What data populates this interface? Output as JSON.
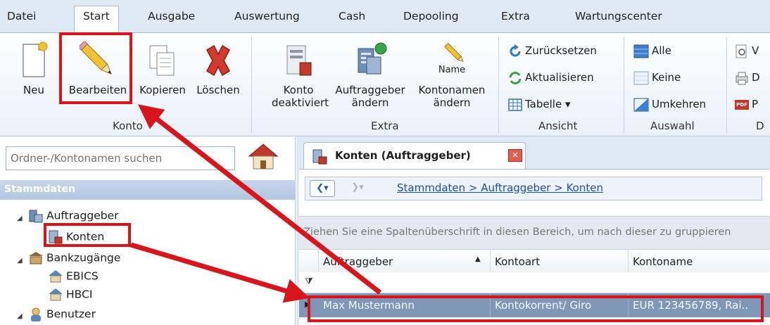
{
  "menu": {
    "tabs": [
      "Datei",
      "Start",
      "Ausgabe",
      "Auswertung",
      "Cash",
      "Depooling",
      "Extra",
      "Wartungscenter"
    ],
    "active": "Start"
  },
  "ribbon": {
    "konto": {
      "group_label": "Konto",
      "buttons": [
        "Neu",
        "Bearbeiten",
        "Kopieren",
        "Löschen"
      ]
    },
    "extra": {
      "group_label": "Extra",
      "konto_deaktiviert": [
        "Konto",
        "deaktiviert"
      ],
      "auftraggeber_aendern": [
        "Auftraggeber",
        "ändern"
      ],
      "kontonamen_aendern": [
        "Kontonamen",
        "ändern"
      ],
      "name_icon_text": "Name"
    },
    "ansicht": {
      "group_label": "Ansicht",
      "items": [
        "Zurücksetzen",
        "Aktualisieren",
        "Tabelle ▾"
      ]
    },
    "auswahl": {
      "group_label": "Auswahl",
      "items": [
        "Alle",
        "Keine",
        "Umkehren"
      ]
    },
    "cutoff": {
      "items": [
        "V",
        "D",
        "P"
      ],
      "group_label": "D",
      "pdf_icon_text": "PDF"
    }
  },
  "left": {
    "search_placeholder": "Ordner-/Kontonamen suchen",
    "header": "Stammdaten",
    "tree": {
      "auftraggeber": "Auftraggeber",
      "konten": "Konten",
      "bankzugaenge": "Bankzugänge",
      "ebics": "EBICS",
      "hbci": "HBCI",
      "benutzer": "Benutzer"
    }
  },
  "right": {
    "doc_tab": "Konten (Auftraggeber)",
    "breadcrumb": "Stammdaten > Auftraggeber > Konten",
    "group_hint": "Ziehen Sie eine Spaltenüberschrift in diesen Bereich, um nach dieser zu gruppieren",
    "columns": [
      "Auftraggeber",
      "Kontoart",
      "Kontoname"
    ],
    "sort_indicator": "▲",
    "rows": [
      {
        "auftraggeber": "Max Mustermann",
        "kontoart": "Kontokorrent/ Giro",
        "kontoname": "EUR 123456789, Rai.."
      }
    ]
  },
  "colors": {
    "highlight": "#d7151b",
    "selected_row": "#7f97b7",
    "ribbon_bg": "#eaf1fa",
    "tab_bg": "#dfe9f5"
  }
}
